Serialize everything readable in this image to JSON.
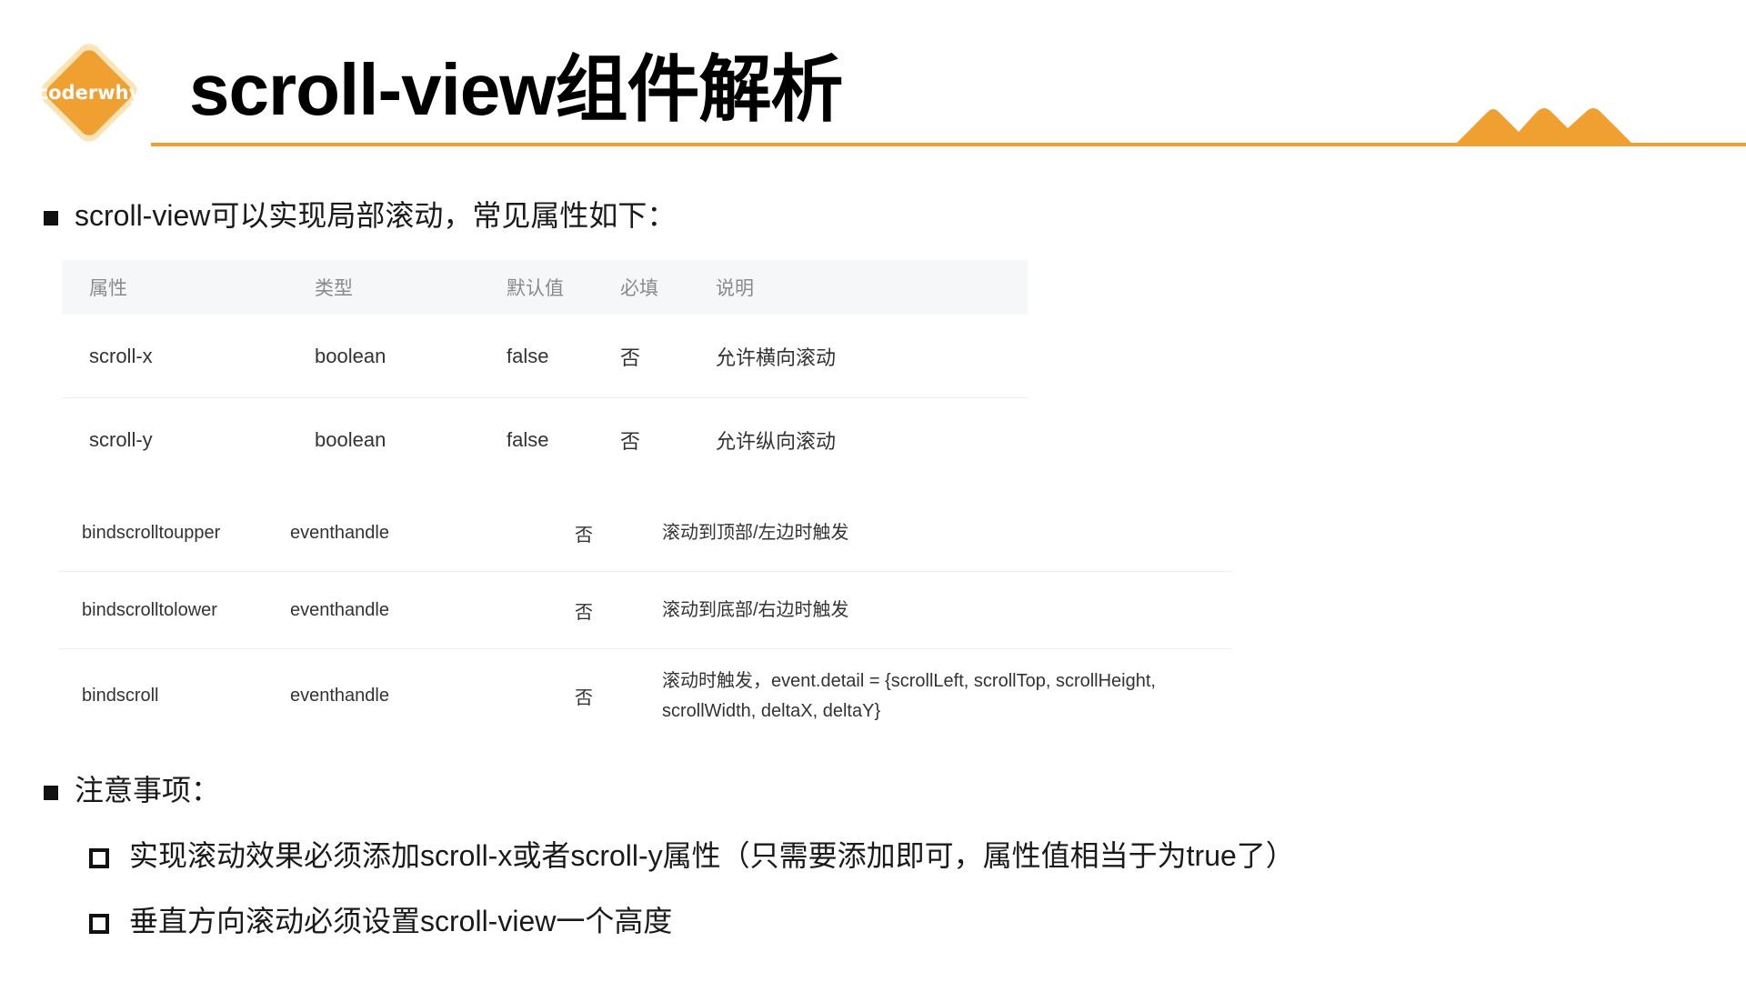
{
  "header": {
    "logo_text": "coderwhy",
    "title": "scroll-view组件解析"
  },
  "intro_text": "scroll-view可以实现局部滚动，常见属性如下：",
  "table1": {
    "headers": [
      "属性",
      "类型",
      "默认值",
      "必填",
      "说明"
    ],
    "rows": [
      [
        "scroll-x",
        "boolean",
        "false",
        "否",
        "允许横向滚动"
      ],
      [
        "scroll-y",
        "boolean",
        "false",
        "否",
        "允许纵向滚动"
      ]
    ]
  },
  "table2": {
    "rows": [
      [
        "bindscrolltoupper",
        "eventhandle",
        "否",
        "滚动到顶部/左边时触发"
      ],
      [
        "bindscrolltolower",
        "eventhandle",
        "否",
        "滚动到底部/右边时触发"
      ],
      [
        "bindscroll",
        "eventhandle",
        "否",
        "滚动时触发，event.detail = {scrollLeft, scrollTop, scrollHeight, scrollWidth, deltaX, deltaY}"
      ]
    ]
  },
  "notes": {
    "title": "注意事项：",
    "items": [
      "实现滚动效果必须添加scroll-x或者scroll-y属性（只需要添加即可，属性值相当于为true了）",
      "垂直方向滚动必须设置scroll-view一个高度"
    ]
  },
  "colors": {
    "accent": "#f0a030",
    "logo_fill": "#f0a030",
    "logo_ring": "#fde3b8"
  }
}
